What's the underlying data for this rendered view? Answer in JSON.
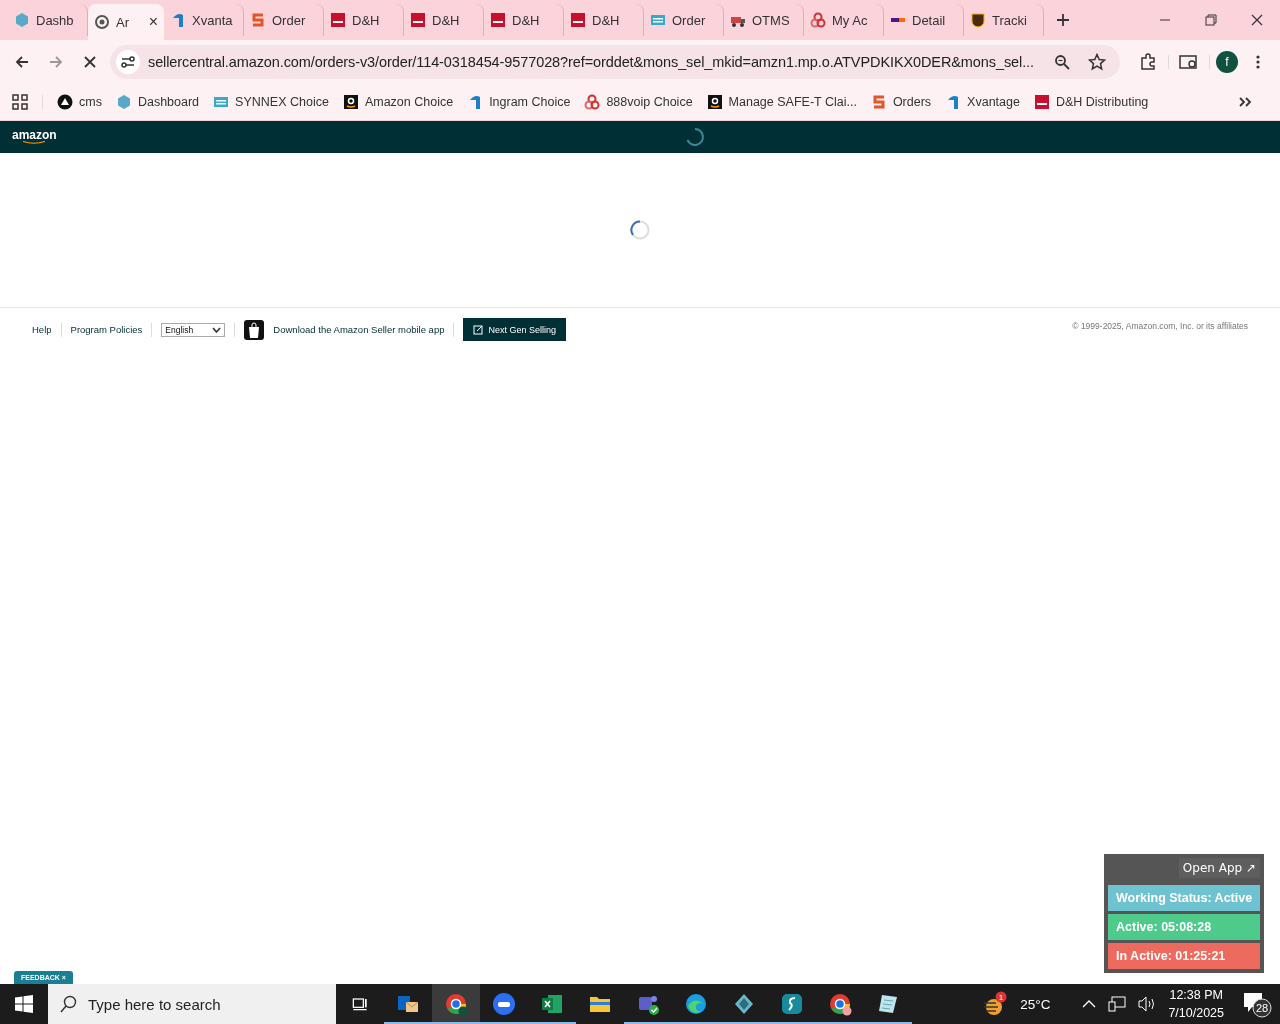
{
  "tabs": [
    {
      "kind": "hex",
      "title": "Dashb",
      "selected": false
    },
    {
      "kind": "globe",
      "title": "Ar",
      "selected": true,
      "close": "×"
    },
    {
      "kind": "xv",
      "title": "Xvanta",
      "selected": false
    },
    {
      "kind": "synnex",
      "title": "Order",
      "selected": false
    },
    {
      "kind": "dh",
      "title": "D&H",
      "selected": false
    },
    {
      "kind": "dh",
      "title": "D&H",
      "selected": false
    },
    {
      "kind": "dh",
      "title": "D&H",
      "selected": false
    },
    {
      "kind": "dh",
      "title": "D&H",
      "selected": false
    },
    {
      "kind": "ec",
      "title": "Order",
      "selected": false
    },
    {
      "kind": "otms",
      "title": "OTMS",
      "selected": false
    },
    {
      "kind": "rings",
      "title": "My Ac",
      "selected": false
    },
    {
      "kind": "fedex",
      "title": "Detail",
      "selected": false
    },
    {
      "kind": "ups",
      "title": "Tracki",
      "selected": false
    }
  ],
  "address_bar": {
    "url": "sellercentral.amazon.com/orders-v3/order/114-0318454-9577028?ref=orddet&mons_sel_mkid=amzn1.mp.o.ATVPDKIKX0DER&mons_sel..."
  },
  "profile": {
    "initial": "f"
  },
  "bookmarks": [
    {
      "kind": "cms",
      "label": "cms"
    },
    {
      "kind": "hex",
      "label": "Dashboard"
    },
    {
      "kind": "ec",
      "label": "SYNNEX Choice"
    },
    {
      "kind": "amazon",
      "label": "Amazon Choice"
    },
    {
      "kind": "xv",
      "label": "Ingram Choice"
    },
    {
      "kind": "rings",
      "label": "888voip Choice"
    },
    {
      "kind": "amazon",
      "label": "Manage SAFE-T Clai..."
    },
    {
      "kind": "synnex",
      "label": "Orders"
    },
    {
      "kind": "xv",
      "label": "Xvantage"
    },
    {
      "kind": "dh",
      "label": "D&H Distributing"
    }
  ],
  "header": {
    "logo": "amazon"
  },
  "footer": {
    "links": [
      "Help",
      "Program Policies"
    ],
    "language": "English",
    "app_link": "Download the Amazon Seller mobile app",
    "next_gen_button": "Next Gen Selling",
    "copyright": "© 1999-2025, Amazon.com, Inc. or its affiliates"
  },
  "feedback": {
    "label": "FEEDBACK",
    "close": "×"
  },
  "tracker_widget": {
    "open_button": "Open App ↗",
    "rows": [
      {
        "text": "Working Status: Active",
        "color": "#6fc2d0"
      },
      {
        "text": "Active: 05:08:28",
        "color": "#4ecb8a"
      },
      {
        "text": "In Active: 01:25:21",
        "color": "#ec6a5e"
      }
    ]
  },
  "taskbar": {
    "search_placeholder": "Type here to search",
    "apps": [
      {
        "kind": "taskview",
        "selected": false,
        "running": false
      },
      {
        "kind": "outlook",
        "selected": false,
        "running": true
      },
      {
        "kind": "chrome",
        "selected": true,
        "running": true
      },
      {
        "kind": "zoom",
        "selected": false,
        "running": true
      },
      {
        "kind": "excel",
        "selected": false,
        "running": true
      },
      {
        "kind": "folder",
        "selected": false,
        "running": false
      },
      {
        "kind": "teams",
        "selected": false,
        "running": true
      },
      {
        "kind": "edge",
        "selected": false,
        "running": true
      },
      {
        "kind": "gem",
        "selected": false,
        "running": true
      },
      {
        "kind": "surfshark",
        "selected": false,
        "running": true
      },
      {
        "kind": "chrome2",
        "selected": false,
        "running": true
      },
      {
        "kind": "notes",
        "selected": false,
        "running": true
      }
    ],
    "weather": {
      "badge": "1",
      "temp": "25°C"
    },
    "time": "12:38 PM",
    "date": "7/10/2025",
    "notifications": "28"
  }
}
